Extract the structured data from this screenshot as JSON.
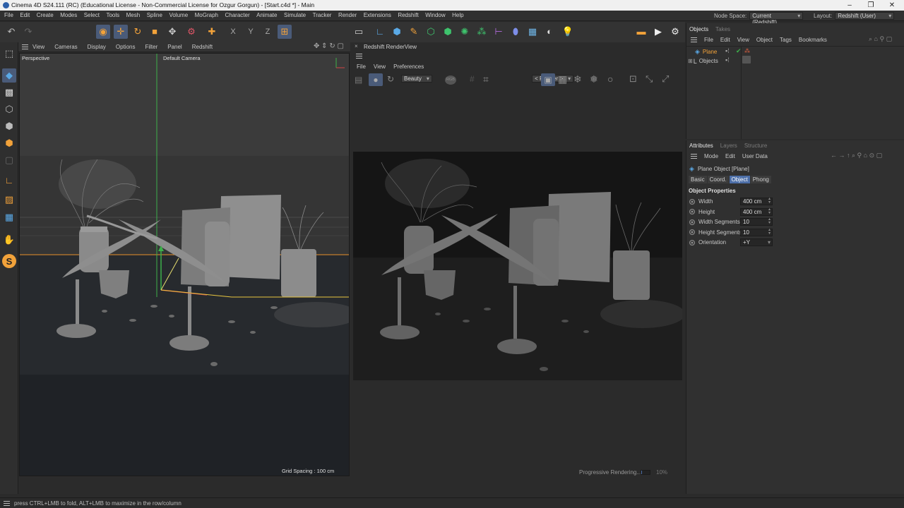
{
  "window": {
    "title": "Cinema 4D S24.111 (RC) (Educational License - Non-Commercial License for Ozgur Gorgun) - [Start.c4d *] - Main",
    "controls": [
      "–",
      "❐",
      "✕"
    ]
  },
  "menubar": {
    "items": [
      "File",
      "Edit",
      "Create",
      "Modes",
      "Select",
      "Tools",
      "Mesh",
      "Spline",
      "Volume",
      "MoGraph",
      "Character",
      "Animate",
      "Simulate",
      "Tracker",
      "Render",
      "Extensions",
      "Redshift",
      "Window",
      "Help"
    ],
    "node_space_label": "Node Space:",
    "node_space_value": "Current (Redshift)",
    "layout_label": "Layout:",
    "layout_value": "Redshift (User)"
  },
  "toolbar": {
    "axis_x": "X",
    "axis_y": "Y",
    "axis_z": "Z"
  },
  "viewport": {
    "menu": [
      "View",
      "Cameras",
      "Display",
      "Options",
      "Filter",
      "Panel",
      "Redshift"
    ],
    "mode_label": "Perspective",
    "camera_label": "Default Camera",
    "grid_spacing": "Grid Spacing : 100 cm"
  },
  "renderview": {
    "title": "Redshift RenderView",
    "menu": [
      "File",
      "View",
      "Preferences"
    ],
    "aov_value": "Beauty",
    "rgb_label": "RGB",
    "render_target": "< Render >",
    "progress_text": "Progressive Rendering...",
    "progress_percent": "10%",
    "progress_fraction": 0.1
  },
  "objects_panel": {
    "tabs": [
      "Objects",
      "Takes"
    ],
    "menu": [
      "File",
      "Edit",
      "View",
      "Object",
      "Tags",
      "Bookmarks"
    ],
    "tree": [
      {
        "name": "Plane",
        "selected": true
      },
      {
        "name": "Objects",
        "selected": false
      }
    ]
  },
  "attributes_panel": {
    "tabs": [
      "Attributes",
      "Layers",
      "Structure"
    ],
    "menu": [
      "Mode",
      "Edit",
      "User Data"
    ],
    "object_title": "Plane Object [Plane]",
    "property_tabs": [
      "Basic",
      "Coord.",
      "Object",
      "Phong"
    ],
    "selected_tab": "Object",
    "section_title": "Object Properties",
    "properties": [
      {
        "label": "Width",
        "value": "400 cm"
      },
      {
        "label": "Height",
        "value": "400 cm"
      },
      {
        "label": "Width Segments",
        "value": "10"
      },
      {
        "label": "Height Segments",
        "value": "10"
      },
      {
        "label": "Orientation",
        "value": "+Y"
      }
    ]
  },
  "statusbar": {
    "hint": "press CTRL+LMB to fold, ALT+LMB to maximize in the row/column"
  },
  "colors": {
    "accent": "#4d6fa8",
    "toolbar_orange": "#f2a23a",
    "y_axis": "#3cb04a",
    "x_axis": "#d24545"
  }
}
